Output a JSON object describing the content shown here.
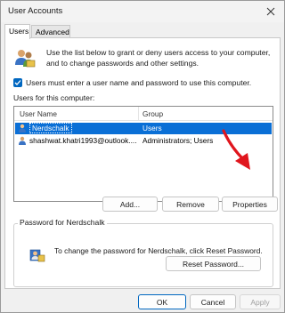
{
  "window": {
    "title": "User Accounts",
    "close_icon": "close-icon"
  },
  "tabs": [
    {
      "label": "Users",
      "active": true
    },
    {
      "label": "Advanced",
      "active": false
    }
  ],
  "intro": {
    "text": "Use the list below to grant or deny users access to your computer, and to change passwords and other settings.",
    "icon": "users-icon"
  },
  "require_password": {
    "label": "Users must enter a user name and password to use this computer.",
    "checked": true
  },
  "users_list": {
    "label": "Users for this computer:",
    "columns": [
      "User Name",
      "Group"
    ],
    "rows": [
      {
        "user": "Nerdschalk",
        "group": "Users",
        "selected": true
      },
      {
        "user": "shashwat.khatri1993@outlook....",
        "group": "Administrators; Users",
        "selected": false
      }
    ]
  },
  "list_buttons": {
    "add": "Add...",
    "remove": "Remove",
    "properties": "Properties"
  },
  "password_group": {
    "title": "Password for Nerdschalk",
    "text": "To change the password for Nerdschalk, click Reset Password.",
    "reset_button": "Reset Password..."
  },
  "dialog_buttons": {
    "ok": "OK",
    "cancel": "Cancel",
    "apply": "Apply"
  },
  "colors": {
    "accent": "#0067c0",
    "selection": "#0a6fd6",
    "annotation_arrow": "#e0161d"
  }
}
